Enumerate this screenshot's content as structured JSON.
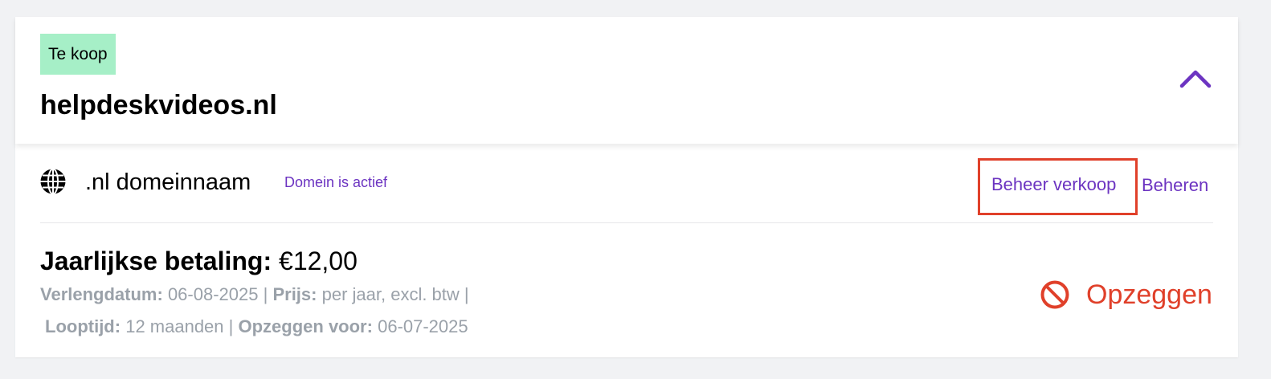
{
  "colors": {
    "accent": "#6c34c1",
    "badge_bg": "#a6efc7",
    "danger": "#e0402a",
    "muted": "#9aa1a9",
    "page_bg": "#f1f2f4"
  },
  "header": {
    "badge": "Te koop",
    "domain": "helpdeskvideos.nl",
    "collapse_icon": "chevron-up-icon"
  },
  "product": {
    "icon": "globe-icon",
    "name": ".nl domeinnaam",
    "status": "Domein is actief"
  },
  "actions": {
    "manage_sale": "Beheer verkoop",
    "manage": "Beheren"
  },
  "payment": {
    "label": "Jaarlijkse betaling:",
    "amount": "€12,00"
  },
  "details": {
    "renewal_label": "Verlengdatum:",
    "renewal_value": "06-08-2025",
    "price_label": "Prijs:",
    "price_value": "per jaar, excl. btw",
    "term_label": "Looptijd:",
    "term_value": "12 maanden",
    "cancel_before_label": "Opzeggen voor:",
    "cancel_before_value": "06-07-2025",
    "separator": "|"
  },
  "cancel": {
    "icon": "prohibited-icon",
    "label": "Opzeggen"
  }
}
